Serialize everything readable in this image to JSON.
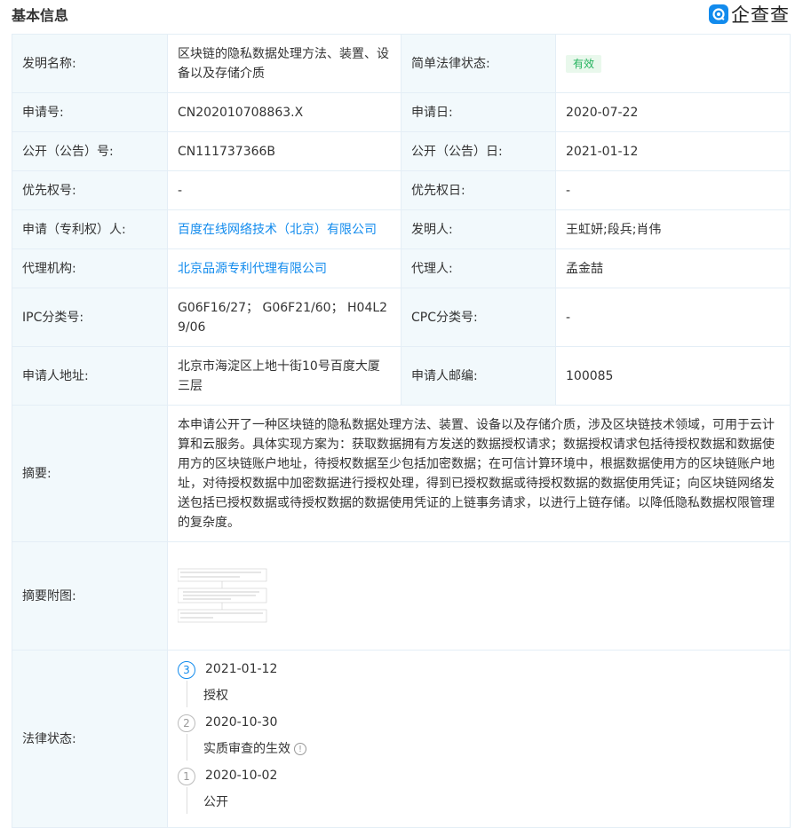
{
  "header": {
    "title": "基本信息",
    "logo_text": "企查查"
  },
  "fields": {
    "invention_name": {
      "label": "发明名称:",
      "value": "区块链的隐私数据处理方法、装置、设备以及存储介质"
    },
    "legal_status_simple": {
      "label": "简单法律状态:",
      "value": "有效"
    },
    "application_no": {
      "label": "申请号:",
      "value": "CN202010708863.X"
    },
    "application_date": {
      "label": "申请日:",
      "value": "2020-07-22"
    },
    "publication_no": {
      "label": "公开（公告）号:",
      "value": "CN111737366B"
    },
    "publication_date": {
      "label": "公开（公告）日:",
      "value": "2021-01-12"
    },
    "priority_no": {
      "label": "优先权号:",
      "value": "-"
    },
    "priority_date": {
      "label": "优先权日:",
      "value": "-"
    },
    "applicant": {
      "label": "申请（专利权）人:",
      "value": "百度在线网络技术（北京）有限公司"
    },
    "inventor": {
      "label": "发明人:",
      "value": "王虹妍;段兵;肖伟"
    },
    "agency": {
      "label": "代理机构:",
      "value": "北京品源专利代理有限公司"
    },
    "agent": {
      "label": "代理人:",
      "value": "孟金喆"
    },
    "ipc": {
      "label": "IPC分类号:",
      "value": "G06F16/27； G06F21/60； H04L29/06"
    },
    "cpc": {
      "label": "CPC分类号:",
      "value": "-"
    },
    "address": {
      "label": "申请人地址:",
      "value": "北京市海淀区上地十街10号百度大厦三层"
    },
    "postcode": {
      "label": "申请人邮编:",
      "value": "100085"
    },
    "abstract": {
      "label": "摘要:",
      "value": "本申请公开了一种区块链的隐私数据处理方法、装置、设备以及存储介质，涉及区块链技术领域，可用于云计算和云服务。具体实现方案为：获取数据拥有方发送的数据授权请求；数据授权请求包括待授权数据和数据使用方的区块链账户地址，待授权数据至少包括加密数据；在可信计算环境中，根据数据使用方的区块链账户地址，对待授权数据中加密数据进行授权处理，得到已授权数据或待授权数据的数据使用凭证；向区块链网络发送包括已授权数据或待授权数据的数据使用凭证的上链事务请求，以进行上链存储。以降低隐私数据权限管理的复杂度。"
    },
    "abstract_figure": {
      "label": "摘要附图:"
    },
    "legal_status": {
      "label": "法律状态:"
    }
  },
  "legal_timeline": [
    {
      "step": "3",
      "date": "2021-01-12",
      "event": "授权",
      "active": true
    },
    {
      "step": "2",
      "date": "2020-10-30",
      "event": "实质审查的生效",
      "has_info_icon": true,
      "active": false
    },
    {
      "step": "1",
      "date": "2020-10-02",
      "event": "公开",
      "active": false
    }
  ],
  "colors": {
    "label_bg": "#f2f9fc",
    "border": "#e4eef6",
    "link": "#128bed",
    "valid_badge_bg": "#e9f8ec",
    "valid_badge_text": "#23b25d"
  }
}
